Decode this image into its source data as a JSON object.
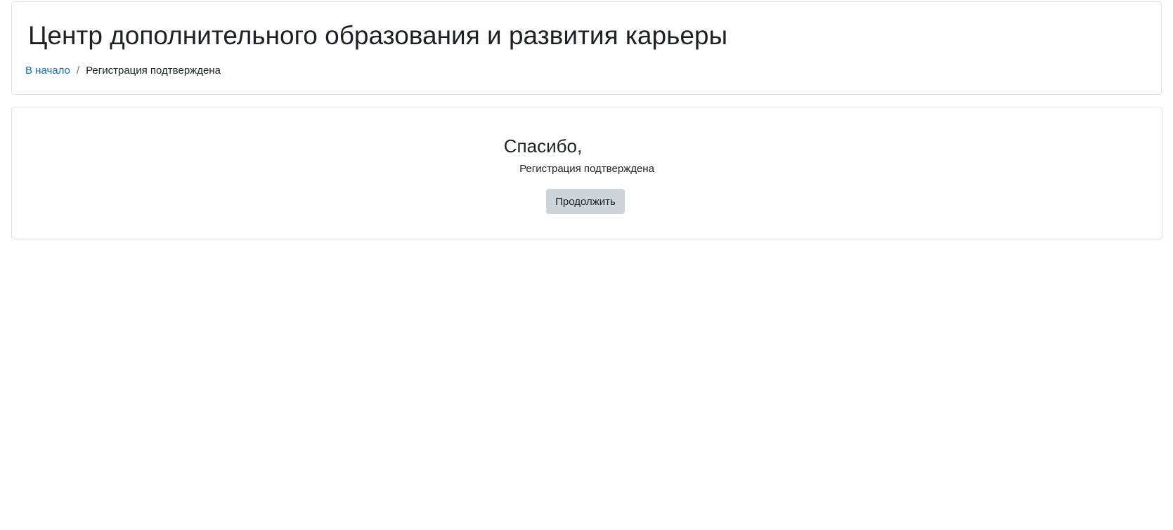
{
  "header": {
    "title": "Центр дополнительного образования и развития карьеры",
    "breadcrumb": {
      "home_label": "В начало",
      "separator": "/",
      "current_label": "Регистрация подтверждена"
    }
  },
  "main": {
    "thanks_text": "Спасибо,",
    "confirmed_message": "Регистрация подтверждена",
    "continue_label": "Продолжить"
  },
  "colors": {
    "link": "#0f6cbf",
    "button_bg": "#ced4da",
    "border": "#dee2e6"
  }
}
